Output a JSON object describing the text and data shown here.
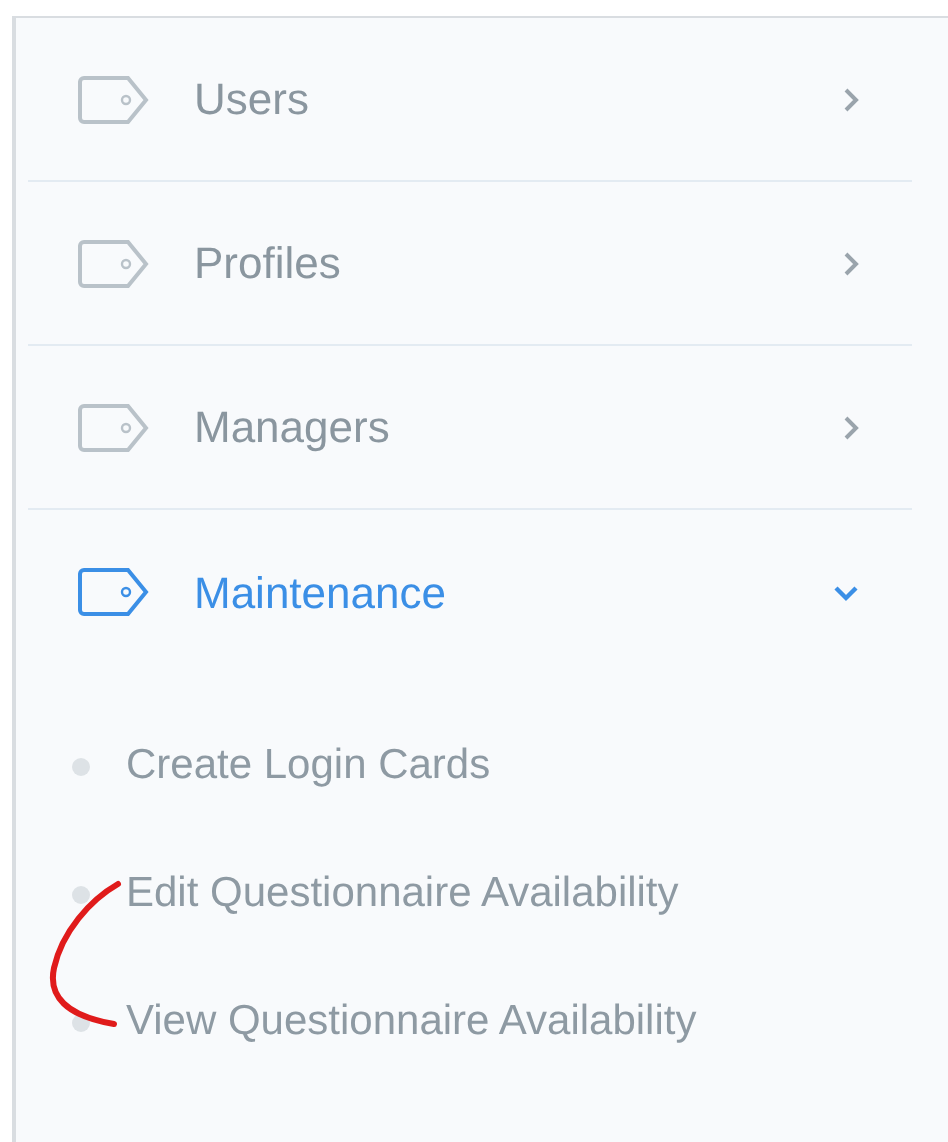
{
  "menu": [
    {
      "label": "Users",
      "expanded": false
    },
    {
      "label": "Profiles",
      "expanded": false
    },
    {
      "label": "Managers",
      "expanded": false
    },
    {
      "label": "Maintenance",
      "expanded": true,
      "children": [
        {
          "label": "Create Login Cards"
        },
        {
          "label": "Edit Questionnaire Availability"
        },
        {
          "label": "View Questionnaire Availability"
        }
      ]
    }
  ]
}
